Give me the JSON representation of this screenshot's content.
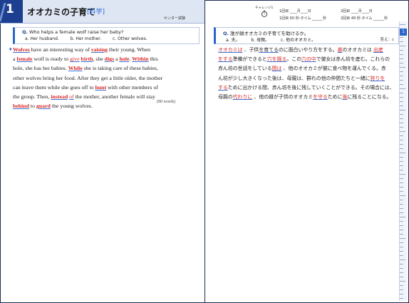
{
  "left": {
    "chapter_number": "1",
    "title": "オオカミの子育て",
    "tag": "[科学]",
    "exam": "センター試験",
    "question": {
      "prefix": "Q.",
      "text": "Who helps a female wolf raise her baby?",
      "options": [
        "a. Her husband.",
        "b. Her mother.",
        "c. Other wolves."
      ]
    },
    "passage_lines": [
      [
        [
          "kw",
          "Wolves"
        ],
        [
          "t",
          " have an interesting way of "
        ],
        [
          "kw",
          "raising"
        ],
        [
          "t",
          " their young.  When"
        ]
      ],
      [
        [
          "t",
          "a "
        ],
        [
          "kw",
          "female"
        ],
        [
          "t",
          " wolf is ready to "
        ],
        [
          "kwu",
          "give"
        ],
        [
          "t",
          " "
        ],
        [
          "kw",
          "birth"
        ],
        [
          "t",
          ", she "
        ],
        [
          "kw",
          "digs"
        ],
        [
          "t",
          " a "
        ],
        [
          "kw",
          "hole"
        ],
        [
          "t",
          ".  "
        ],
        [
          "kw",
          "Within"
        ],
        [
          "t",
          " this"
        ]
      ],
      [
        [
          "t",
          "hole, she has her babies.  "
        ],
        [
          "kw",
          "While"
        ],
        [
          "t",
          " she is taking care of these babies,"
        ]
      ],
      [
        [
          "t",
          "other wolves bring her food.  After they get a little older, the mother"
        ]
      ],
      [
        [
          "t",
          "can leave them while she goes off to "
        ],
        [
          "kw",
          "hunt"
        ],
        [
          "t",
          " with other members of"
        ]
      ],
      [
        [
          "t",
          "the group.  Then, "
        ],
        [
          "kw",
          "instead"
        ],
        [
          "t",
          " "
        ],
        [
          "kwu",
          "of"
        ],
        [
          "t",
          " the mother, another female will stay"
        ]
      ],
      [
        [
          "kw",
          "behind"
        ],
        [
          "t",
          " to "
        ],
        [
          "kw",
          "guard"
        ],
        [
          "t",
          " the young wolves."
        ]
      ]
    ],
    "word_count": "(80 words)"
  },
  "right": {
    "challenge_label": "チャレンジ1",
    "date1": "1回目 ____月____日",
    "date2": "2回目 ____月____日",
    "time1": "1回目 60 秒-タイム ______秒",
    "time2": "2回目 48 秒-タイム ______秒",
    "question": {
      "prefix": "Q.",
      "text": "誰が雌オオカミの子育てを助けるか。",
      "options": [
        "a. 夫。",
        "b. 母親。",
        "c. 他のオオカミ。"
      ]
    },
    "answer_label": "答え：c",
    "translation_lines": [
      [
        [
          "jr",
          "オオカミは"
        ],
        [
          "t",
          " 、子供"
        ],
        [
          "jb",
          "を育てる"
        ],
        [
          "t",
          "のに面白いやり方をする。"
        ],
        [
          "jr",
          "雌"
        ],
        [
          "t",
          "のオオカミは "
        ],
        [
          "jr",
          "出産"
        ]
      ],
      [
        [
          "jr",
          "をする"
        ],
        [
          "t",
          "準備ができると"
        ],
        [
          "jr",
          "穴を掘る"
        ],
        [
          "t",
          "。この"
        ],
        [
          "jr",
          "穴の中"
        ],
        [
          "t",
          "で彼女は赤ん坊を産む。これらの"
        ]
      ],
      [
        [
          "t",
          "赤ん坊の世話をしている"
        ],
        [
          "jr",
          "間は"
        ],
        [
          "t",
          " 、他のオオカミが彼に食べ物を運んでくる。赤"
        ]
      ],
      [
        [
          "t",
          "ん坊が少し大きくなった後は、母親は、群れの他の仲間たちと一緒に"
        ],
        [
          "jr",
          "狩りを"
        ]
      ],
      [
        [
          "jr",
          "する"
        ],
        [
          "t",
          "ために出かける間、赤ん坊を後に残していくことができる。その場合には、"
        ]
      ],
      [
        [
          "t",
          "母親の"
        ],
        [
          "jr",
          "代わりに"
        ],
        [
          "t",
          " 、他の雌が子供のオオカミ"
        ],
        [
          "jr",
          "を守る"
        ],
        [
          "t",
          "ために"
        ],
        [
          "jr",
          "後"
        ],
        [
          "t",
          "に残ることになる。"
        ]
      ]
    ]
  }
}
